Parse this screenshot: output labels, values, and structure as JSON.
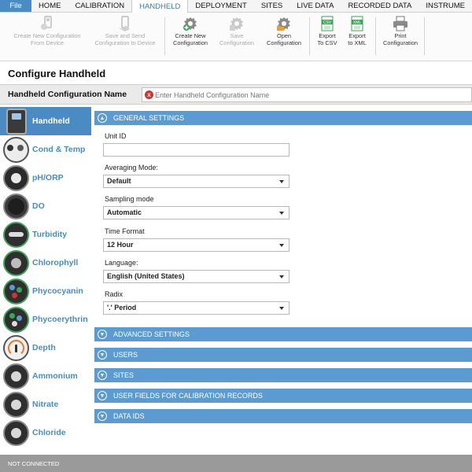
{
  "menu": {
    "items": [
      "File",
      "HOME",
      "CALIBRATION",
      "HANDHELD",
      "DEPLOYMENT",
      "SITES",
      "LIVE DATA",
      "RECORDED DATA",
      "INSTRUME"
    ],
    "active": "HANDHELD"
  },
  "ribbon": {
    "create_from_device": "Create New Configuration\nFrom Device",
    "save_send": "Save and Send\nConfiguration to Device",
    "create_new": "Create New\nConfiguration",
    "save": "Save\nConfiguration",
    "open": "Open\nConfiguration",
    "export_csv": "Export\nTo CSV",
    "export_xml": "Export\nto XML",
    "print": "Print\nConfiguration",
    "csv_badge": "CSV",
    "xml_badge": "XML"
  },
  "page": {
    "title": "Configure Handheld",
    "name_label": "Handheld Configuration Name",
    "name_placeholder": "Enter Handheld Configuration Name",
    "error_icon": "x"
  },
  "sidebar": {
    "items": [
      {
        "label": "Handheld",
        "icon": "handheld-icon"
      },
      {
        "label": "Cond & Temp",
        "icon": "cond-temp-sensor-icon"
      },
      {
        "label": "pH/ORP",
        "icon": "ph-orp-sensor-icon"
      },
      {
        "label": "DO",
        "icon": "do-sensor-icon"
      },
      {
        "label": "Turbidity",
        "icon": "turbidity-sensor-icon"
      },
      {
        "label": "Chlorophyll",
        "icon": "chlorophyll-sensor-icon"
      },
      {
        "label": "Phycocyanin",
        "icon": "phycocyanin-sensor-icon"
      },
      {
        "label": "Phycoerythrin",
        "icon": "phycoerythrin-sensor-icon"
      },
      {
        "label": "Depth",
        "icon": "depth-sensor-icon"
      },
      {
        "label": "Ammonium",
        "icon": "ammonium-sensor-icon"
      },
      {
        "label": "Nitrate",
        "icon": "nitrate-sensor-icon"
      },
      {
        "label": "Chloride",
        "icon": "chloride-sensor-icon"
      }
    ]
  },
  "general": {
    "header": "GENERAL SETTINGS",
    "unit_id_label": "Unit ID",
    "unit_id_value": "",
    "averaging_label": "Averaging Mode:",
    "averaging_value": "Default",
    "sampling_label": "Sampling mode",
    "sampling_value": "Automatic",
    "time_label": "Time Format",
    "time_value": "12 Hour",
    "language_label": "Language:",
    "language_value": "English (United States)",
    "radix_label": "Radix",
    "radix_value": "'.' Period"
  },
  "sections": {
    "advanced": "ADVANCED SETTINGS",
    "users": "USERS",
    "sites": "SITES",
    "user_fields": "USER FIELDS FOR CALIBRATION RECORDS",
    "data_ids": "DATA IDS"
  },
  "status": {
    "text": "NOT CONNECTED"
  },
  "colors": {
    "accent": "#4a8bc4",
    "panel_header": "#5b9bd1",
    "status_bar": "#9a9a9a",
    "error": "#d0342c"
  }
}
